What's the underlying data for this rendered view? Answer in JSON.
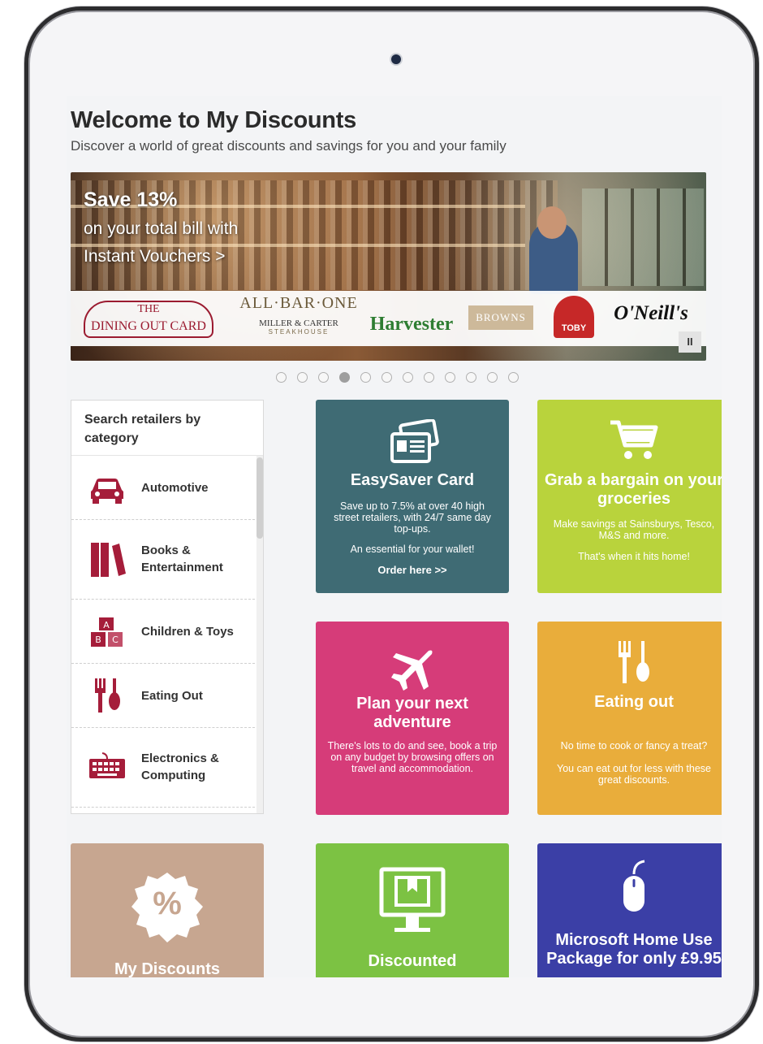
{
  "page": {
    "title": "Welcome to My Discounts",
    "subtitle": "Discover a world of great discounts and savings for you and your family"
  },
  "banner": {
    "headline": "Save 13%",
    "line2": "on your total bill with",
    "line3": "Instant Vouchers >",
    "logos": {
      "dining_line1": "THE",
      "dining_line2": "DINING OUT CARD",
      "allbar_line1": "ALL·BAR·ONE",
      "allbar_line2": "MILLER & CARTER",
      "allbar_line3": "STEAKHOUSE",
      "harvester": "Harvester",
      "browns": "BROWNS",
      "toby": "TOBY",
      "oneills": "O'Neill's"
    },
    "pause_label": "II",
    "slide_count": 12,
    "active_slide": 4
  },
  "categories": {
    "heading": "Search retailers by category",
    "items": [
      {
        "label": "Automotive",
        "icon": "car-icon"
      },
      {
        "label": "Books & Entertainment",
        "icon": "books-icon"
      },
      {
        "label": "Children & Toys",
        "icon": "toy-blocks-icon"
      },
      {
        "label": "Eating Out",
        "icon": "cutlery-icon"
      },
      {
        "label": "Electronics & Computing",
        "icon": "keyboard-icon"
      }
    ]
  },
  "tiles": {
    "easysaver": {
      "title": "EasySaver Card",
      "text": "Save up to 7.5% at over 40 high street retailers, with 24/7 same day top-ups.",
      "text2": "An essential for your wallet!",
      "cta": "Order here >>",
      "color": "#3f6b74"
    },
    "groceries": {
      "title": "Grab a bargain on your groceries",
      "text": "Make savings at Sainsburys, Tesco, M&S and more.",
      "text2": "That's when it hits home!",
      "color": "#b9d33c"
    },
    "travel": {
      "title": "Plan your next adventure",
      "text": "There's lots to do and see, book a trip on any budget by browsing offers on travel and accommodation.",
      "color": "#d63c79"
    },
    "eating": {
      "title": "Eating out",
      "text": "No time to cook or fancy a treat?",
      "text2": "You can eat out for less with these great discounts.",
      "color": "#e9ad3b"
    },
    "mydiscounts": {
      "title": "My Discounts",
      "badge": "%",
      "color": "#c7a690"
    },
    "discounted": {
      "title": "Discounted",
      "color": "#7cc243"
    },
    "microsoft": {
      "title": "Microsoft Home Use Package for only £9.95",
      "color": "#3b3fa6"
    }
  }
}
